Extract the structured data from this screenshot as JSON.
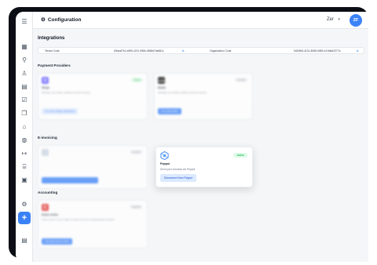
{
  "topbar": {
    "title": "Configuration",
    "org": "Zer",
    "avatar_initials": "ZF"
  },
  "integrations": {
    "heading": "Integrations",
    "tenant_code_label": "Tenant Code",
    "tenant_code_value": "b9dcaf7b1-e895-4221-958b-3568d7de681c",
    "org_code_label": "Organization Code",
    "org_code_value": "9d19fb8-4131-8088-9489-e216fdd2077a"
  },
  "payment_providers": {
    "heading": "Payment Providers",
    "stripe": {
      "name": "Stripe",
      "badge": "Active",
      "desc": "Manage your Stripe settings and link invoices.",
      "button": "Go to the Stripe dashboard"
    },
    "mollie": {
      "name": "Mollie",
      "badge": "Inactive",
      "desc": "Manage your Mollie settings and link invoices.",
      "button": "Link with Mollie"
    }
  },
  "einvoicing": {
    "heading": "E-invoicing",
    "blurred": {
      "name": "",
      "badge": "Inactive",
      "button": ""
    },
    "peppol": {
      "name": "Peppol",
      "badge": "Active",
      "desc": "Send your invoices via Peppol",
      "button": "Disconnect from Peppol"
    }
  },
  "accounting": {
    "heading": "Accounting",
    "exact": {
      "name": "Exact online",
      "badge": "Inactive",
      "desc": "Keep control of your sales invoices and your bookkeeping via Exact.",
      "button": "Link with Exact Online"
    }
  },
  "colors": {
    "accent": "#3b82f6",
    "stripe": "#635bff",
    "exact": "#e0312f",
    "active": "#16a34a"
  }
}
